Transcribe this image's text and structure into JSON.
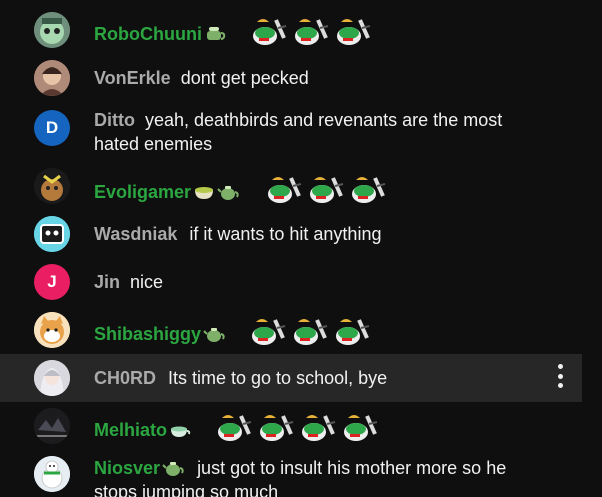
{
  "messages": [
    {
      "author": "RoboChuuni",
      "text": "",
      "member": true,
      "badges": [
        "tea-cup-badge"
      ],
      "emotes": 3,
      "avatar": "robot"
    },
    {
      "author": "VonErkle",
      "text": "dont get pecked",
      "member": false,
      "badges": [],
      "emotes": 0,
      "avatar": "photo"
    },
    {
      "author": "Ditto",
      "text": "yeah, deathbirds and revenants are the most hated enemies",
      "member": false,
      "badges": [],
      "emotes": 0,
      "avatar": "letter",
      "avatar_letter": "D",
      "avatar_color": "#1565c0"
    },
    {
      "author": "Evoligamer",
      "text": "",
      "member": true,
      "badges": [
        "soup-bowl-badge",
        "teapot-badge"
      ],
      "emotes": 3,
      "avatar": "creature"
    },
    {
      "author": "Wasdniak",
      "text": "if it wants to hit anything",
      "member": false,
      "badges": [],
      "emotes": 0,
      "avatar": "robot-blue"
    },
    {
      "author": "Jin",
      "text": "nice",
      "member": false,
      "badges": [],
      "emotes": 0,
      "avatar": "letter",
      "avatar_letter": "J",
      "avatar_color": "#e91e63"
    },
    {
      "author": "Shibashiggy",
      "text": "",
      "member": true,
      "badges": [
        "teapot-badge"
      ],
      "emotes": 3,
      "avatar": "dog"
    },
    {
      "author": "CH0RD",
      "text": "Its time to go to school, bye",
      "member": false,
      "badges": [],
      "emotes": 0,
      "avatar": "anime"
    },
    {
      "author": "Melhiato",
      "text": "",
      "member": true,
      "badges": [
        "tea-cup-badge"
      ],
      "emotes": 4,
      "avatar": "dark"
    },
    {
      "author": "Niosver",
      "text": "just got to insult his mother more so he stops jumping so much",
      "member": true,
      "badges": [
        "teapot-badge"
      ],
      "emotes": 0,
      "avatar": "snowman"
    }
  ],
  "colors": {
    "member": "#2ba640",
    "plain": "#aaaaaa",
    "highlight": "#272727"
  }
}
